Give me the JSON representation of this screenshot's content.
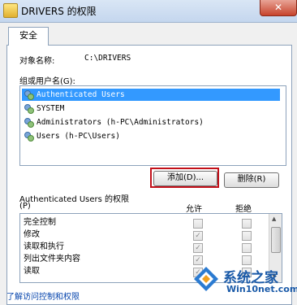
{
  "window": {
    "title": "DRIVERS 的权限",
    "close_label": "✕"
  },
  "tabs": [
    {
      "label": "安全"
    }
  ],
  "object": {
    "label": "对象名称:",
    "value": "C:\\DRIVERS"
  },
  "group_label": "组或用户名(G):",
  "users": [
    {
      "name": "Authenticated Users",
      "selected": true
    },
    {
      "name": "SYSTEM",
      "selected": false
    },
    {
      "name": "Administrators (h-PC\\Administrators)",
      "selected": false
    },
    {
      "name": "Users (h-PC\\Users)",
      "selected": false
    }
  ],
  "buttons": {
    "add": "添加(D)...",
    "remove": "删除(R)"
  },
  "permissions": {
    "title": "Authenticated Users 的权限",
    "title_suffix": "(P)",
    "allow_label": "允许",
    "deny_label": "拒绝",
    "rows": [
      {
        "name": "完全控制",
        "allow": false,
        "deny": false
      },
      {
        "name": "修改",
        "allow": true,
        "deny": false
      },
      {
        "name": "读取和执行",
        "allow": true,
        "deny": false
      },
      {
        "name": "列出文件夹内容",
        "allow": true,
        "deny": false
      },
      {
        "name": "读取",
        "allow": true,
        "deny": false
      }
    ]
  },
  "link": "了解访问控制和权限",
  "watermark": {
    "line1": "系统之家",
    "line2": "Win10net.com"
  }
}
